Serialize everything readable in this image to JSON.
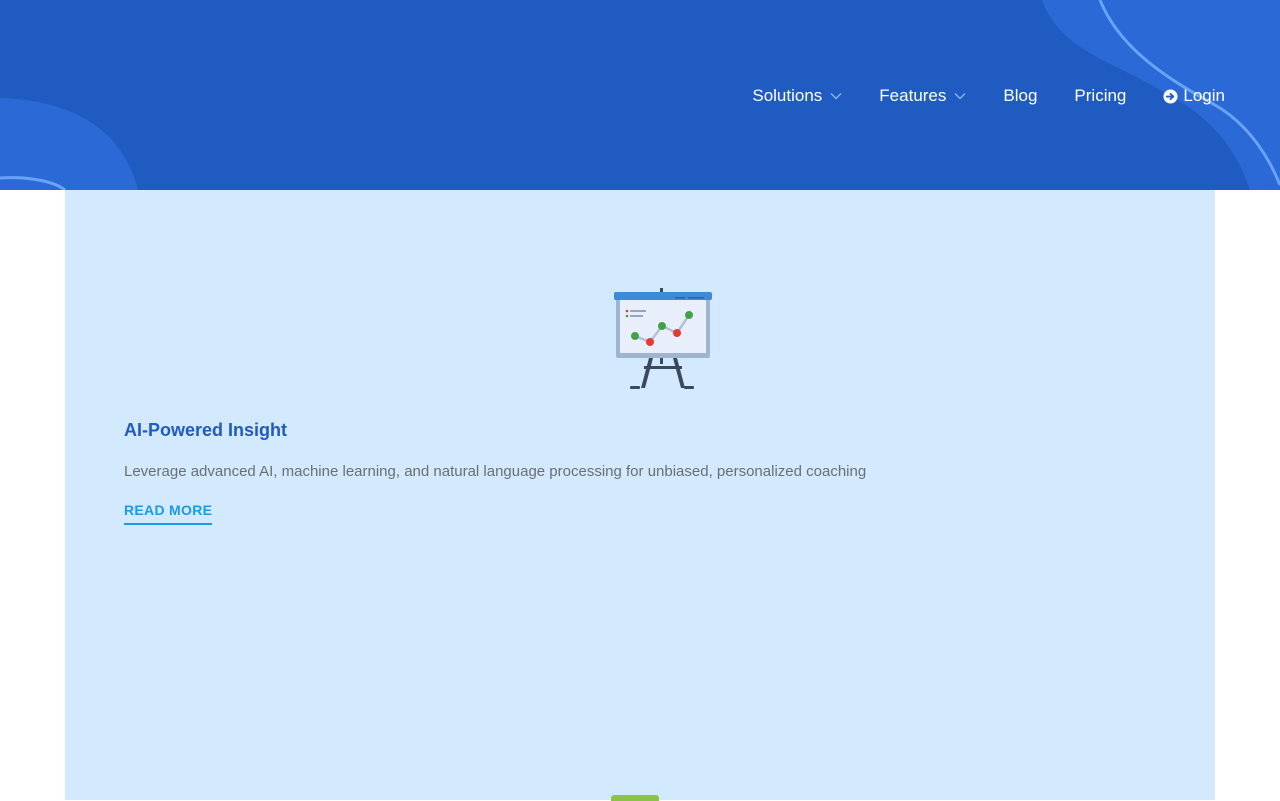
{
  "nav": {
    "items": [
      {
        "label": "Solutions",
        "has_dropdown": true
      },
      {
        "label": "Features",
        "has_dropdown": true
      },
      {
        "label": "Blog",
        "has_dropdown": false
      },
      {
        "label": "Pricing",
        "has_dropdown": false
      }
    ],
    "login_label": "Login",
    "login_icon": "arrow-circle-right-icon"
  },
  "card": {
    "icon": "presentation-chart-icon",
    "title": "AI-Powered Insight",
    "description": "Leverage advanced AI, machine learning, and natural language processing for unbiased, personalized coaching",
    "link_label": "READ MORE"
  },
  "colors": {
    "header_bg": "#1f5bc0",
    "panel_bg": "#d3e9fd",
    "title": "#1f5bc0",
    "link": "#1a9be6"
  }
}
